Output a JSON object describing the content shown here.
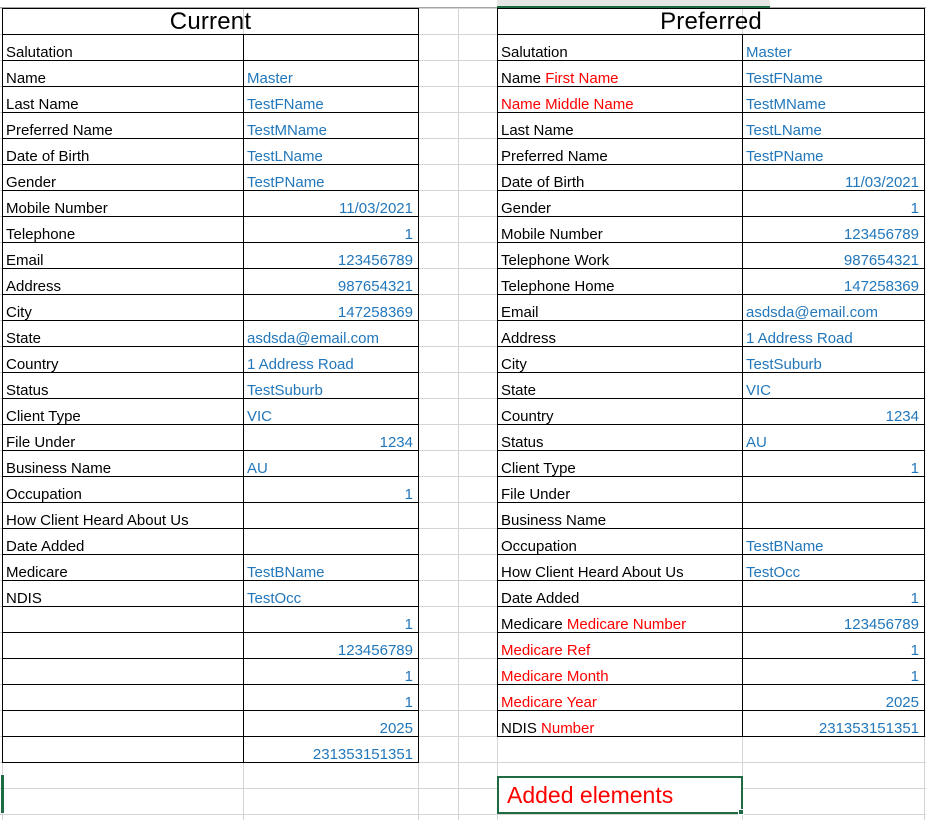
{
  "document": {
    "type": "spreadsheet-comparison",
    "colors": {
      "value_blue": "#2277bb",
      "added_red": "#ff0000",
      "selection_green": "#1e6b43",
      "label_black": "#000000",
      "gridline": "#d4d4d4"
    }
  },
  "tables": [
    {
      "id": "current",
      "title": "Current",
      "rows": [
        {
          "label": "Salutation",
          "value": "",
          "align": "left"
        },
        {
          "label": "Name",
          "value": "Master",
          "align": "left"
        },
        {
          "label": "Last Name",
          "value": "TestFName",
          "align": "left"
        },
        {
          "label": "Preferred Name",
          "value": "TestMName",
          "align": "left"
        },
        {
          "label": "Date of Birth",
          "value": "TestLName",
          "align": "left"
        },
        {
          "label": "Gender",
          "value": "TestPName",
          "align": "left"
        },
        {
          "label": "Mobile Number",
          "value": "11/03/2021",
          "align": "right"
        },
        {
          "label": "Telephone",
          "value": "1",
          "align": "right"
        },
        {
          "label": "Email",
          "value": "123456789",
          "align": "right"
        },
        {
          "label": "Address",
          "value": "987654321",
          "align": "right"
        },
        {
          "label": "City",
          "value": "147258369",
          "align": "right"
        },
        {
          "label": "State",
          "value": "asdsda@email.com",
          "align": "left"
        },
        {
          "label": "Country",
          "value": "1 Address Road",
          "align": "left"
        },
        {
          "label": "Status",
          "value": "TestSuburb",
          "align": "left"
        },
        {
          "label": "Client Type",
          "value": "VIC",
          "align": "left"
        },
        {
          "label": "File Under",
          "value": "1234",
          "align": "right"
        },
        {
          "label": "Business Name",
          "value": "AU",
          "align": "left"
        },
        {
          "label": "Occupation",
          "value": "1",
          "align": "right"
        },
        {
          "label": "How Client Heard About Us",
          "value": "",
          "align": "left"
        },
        {
          "label": "Date Added",
          "value": "",
          "align": "left"
        },
        {
          "label": "Medicare",
          "value": "TestBName",
          "align": "left"
        },
        {
          "label": "NDIS",
          "value": "TestOcc",
          "align": "left"
        },
        {
          "label": "",
          "value": "1",
          "align": "right"
        },
        {
          "label": "",
          "value": "123456789",
          "align": "right"
        },
        {
          "label": "",
          "value": "1",
          "align": "right"
        },
        {
          "label": "",
          "value": "1",
          "align": "right"
        },
        {
          "label": "",
          "value": "2025",
          "align": "right"
        },
        {
          "label": "",
          "value": "231353151351",
          "align": "right"
        }
      ]
    },
    {
      "id": "preferred",
      "title": "Preferred",
      "rows": [
        {
          "label": "Salutation",
          "label_red": "",
          "value": "Master",
          "align": "left"
        },
        {
          "label": "Name",
          "label_red": "First Name",
          "value": "TestFName",
          "align": "left"
        },
        {
          "label": "",
          "label_red": "Name Middle Name",
          "value": "TestMName",
          "align": "left"
        },
        {
          "label": "Last Name",
          "label_red": "",
          "value": "TestLName",
          "align": "left"
        },
        {
          "label": "Preferred Name",
          "label_red": "",
          "value": "TestPName",
          "align": "left"
        },
        {
          "label": "Date of Birth",
          "label_red": "",
          "value": "11/03/2021",
          "align": "right"
        },
        {
          "label": "Gender",
          "label_red": "",
          "value": "1",
          "align": "right"
        },
        {
          "label": "Mobile Number",
          "label_red": "",
          "value": "123456789",
          "align": "right"
        },
        {
          "label": "Telephone Work",
          "label_red": "",
          "value": "987654321",
          "align": "right"
        },
        {
          "label": "Telephone Home",
          "label_red": "",
          "value": "147258369",
          "align": "right"
        },
        {
          "label": "Email",
          "label_red": "",
          "value": "asdsda@email.com",
          "align": "left"
        },
        {
          "label": "Address",
          "label_red": "",
          "value": "1 Address Road",
          "align": "left"
        },
        {
          "label": "City",
          "label_red": "",
          "value": "TestSuburb",
          "align": "left"
        },
        {
          "label": "State",
          "label_red": "",
          "value": "VIC",
          "align": "left"
        },
        {
          "label": "Country",
          "label_red": "",
          "value": "1234",
          "align": "right"
        },
        {
          "label": "Status",
          "label_red": "",
          "value": "AU",
          "align": "left"
        },
        {
          "label": "Client Type",
          "label_red": "",
          "value": "1",
          "align": "right"
        },
        {
          "label": "File Under",
          "label_red": "",
          "value": "",
          "align": "left"
        },
        {
          "label": "Business Name",
          "label_red": "",
          "value": "",
          "align": "left"
        },
        {
          "label": "Occupation",
          "label_red": "",
          "value": "TestBName",
          "align": "left"
        },
        {
          "label": "How Client Heard About Us",
          "label_red": "",
          "value": "TestOcc",
          "align": "left"
        },
        {
          "label": "Date Added",
          "label_red": "",
          "value": "1",
          "align": "right"
        },
        {
          "label": "Medicare",
          "label_red": "Medicare Number",
          "value": "123456789",
          "align": "right"
        },
        {
          "label": "",
          "label_red": "Medicare Ref",
          "value": "1",
          "align": "right"
        },
        {
          "label": "",
          "label_red": "Medicare Month",
          "value": "1",
          "align": "right"
        },
        {
          "label": "",
          "label_red": "Medicare Year",
          "value": "2025",
          "align": "right"
        },
        {
          "label": "NDIS",
          "label_red": "Number",
          "value": "231353151351",
          "align": "right"
        }
      ]
    }
  ],
  "callout": {
    "text": "Added elements"
  }
}
